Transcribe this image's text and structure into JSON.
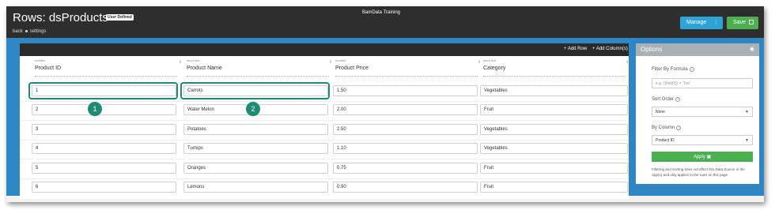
{
  "header": {
    "title": "Rows: dsProducts",
    "badge": "User Defined",
    "breadcrumb": [
      "back",
      "settings"
    ],
    "app_name": "BamData Training",
    "manage_label": "Manage",
    "save_label": "Save"
  },
  "toolbar": {
    "add_row": "+ Add Row",
    "add_columns": "+ Add Column(s)"
  },
  "columns": [
    {
      "type": "number",
      "name": "Product ID"
    },
    {
      "type": "short text",
      "name": "Product Name"
    },
    {
      "type": "number",
      "name": "Product Price"
    },
    {
      "type": "short text",
      "name": "Category"
    }
  ],
  "rows": [
    [
      "1",
      "Carrots",
      "1.50",
      "Vegetables"
    ],
    [
      "2",
      "Water Melon",
      "2.00",
      "Fruit"
    ],
    [
      "3",
      "Potatoes",
      "2.50",
      "Vegetables"
    ],
    [
      "4",
      "Turnips",
      "1.10",
      "Vegetables"
    ],
    [
      "5",
      "Oranges",
      "0.75",
      "Fruit"
    ],
    [
      "6",
      "Lemons",
      "0.90",
      "Fruit"
    ]
  ],
  "callouts": [
    "1",
    "2"
  ],
  "options": {
    "title": "Options",
    "filter_label": "Filter By Formula",
    "filter_placeholder": "e.g. ({field2}) = 'Yes'",
    "sort_label": "Sort Order",
    "sort_value": "None",
    "bycol_label": "By Column",
    "bycol_value": "Product ID",
    "apply_label": "Apply",
    "note": "Filtering and Sorting does not affect this Data Source in the App(s) and only applies to the rows on this page."
  },
  "colors": {
    "accent_blue": "#2f86c4",
    "success_green": "#4caf50",
    "callout_teal": "#1e8c74",
    "topbar": "#2e2e2e"
  }
}
